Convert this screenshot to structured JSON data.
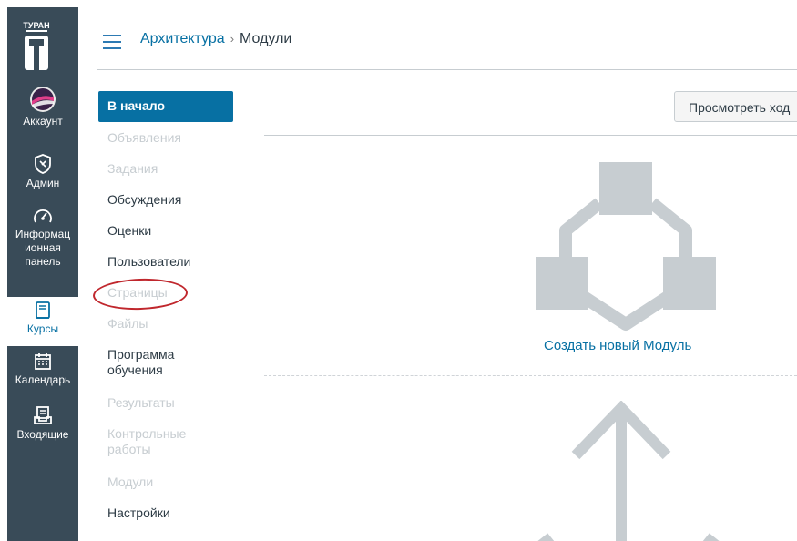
{
  "global_nav": {
    "logo_text": "ТУРАН",
    "items": [
      {
        "label": "Аккаунт",
        "icon": "avatar"
      },
      {
        "label": "Админ",
        "icon": "shield-icon"
      },
      {
        "label": "Информационная панель",
        "label_lines": [
          "Информац",
          "ионная",
          "панель"
        ],
        "icon": "dashboard-icon"
      },
      {
        "label": "Курсы",
        "icon": "book-icon",
        "active": true
      },
      {
        "label": "Календарь",
        "icon": "calendar-icon"
      },
      {
        "label": "Входящие",
        "icon": "inbox-icon"
      }
    ]
  },
  "header": {
    "breadcrumb": [
      {
        "label": "Архитектура",
        "link": true
      },
      {
        "label": "Модули",
        "link": false
      }
    ],
    "separator": "›"
  },
  "course_nav": {
    "items": [
      {
        "label": "В начало",
        "state": "active"
      },
      {
        "label": "Объявления",
        "state": "disabled"
      },
      {
        "label": "Задания",
        "state": "disabled"
      },
      {
        "label": "Обсуждения",
        "state": "enabled"
      },
      {
        "label": "Оценки",
        "state": "enabled"
      },
      {
        "label": "Пользователи",
        "state": "enabled"
      },
      {
        "label": "Страницы",
        "state": "disabled"
      },
      {
        "label": "Файлы",
        "state": "disabled"
      },
      {
        "label": "Программа обучения",
        "label_lines": [
          "Программа",
          "обучения"
        ],
        "state": "enabled"
      },
      {
        "label": "Результаты",
        "state": "disabled"
      },
      {
        "label": "Контрольные работы",
        "label_lines": [
          "Контрольные",
          "работы"
        ],
        "state": "disabled"
      },
      {
        "label": "Модули",
        "state": "disabled"
      },
      {
        "label": "Настройки",
        "state": "enabled"
      }
    ]
  },
  "main": {
    "view_progress_button": "Просмотреть ход",
    "create_module_link": "Создать новый Модуль"
  },
  "colors": {
    "nav_bg": "#394b58",
    "accent": "#0770a3",
    "annotation": "#c0272d",
    "illustration": "#c7cdd1"
  }
}
